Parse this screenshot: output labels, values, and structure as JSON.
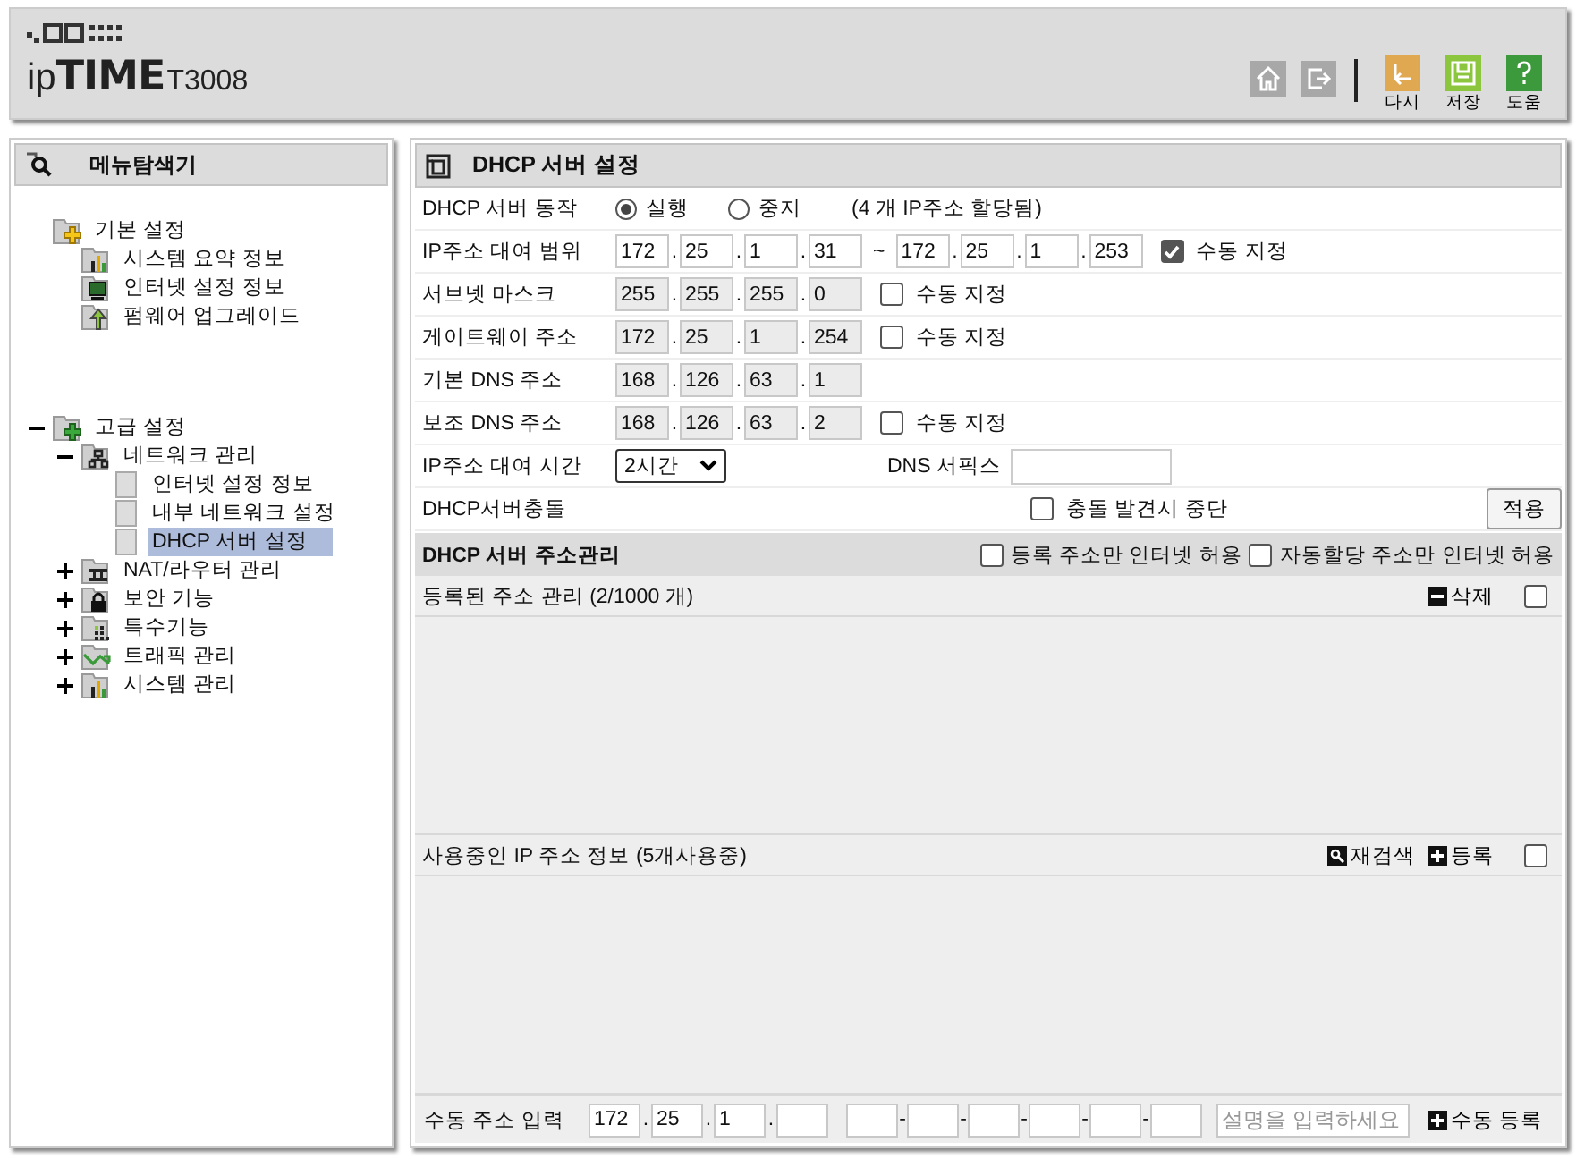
{
  "header": {
    "logo": {
      "prefix": "ip",
      "name": "TIME",
      "model": "T3008"
    },
    "tools": [
      {
        "kind": "home"
      },
      {
        "kind": "logout"
      }
    ],
    "actions": [
      {
        "kind": "undo",
        "label": "다시",
        "color": "#e0a850"
      },
      {
        "kind": "save",
        "label": "저장",
        "color": "#8cc63e"
      },
      {
        "kind": "help",
        "label": "도움",
        "color": "#3c9a3c"
      }
    ]
  },
  "sidebar": {
    "title": "메뉴탐색기",
    "tree": [
      {
        "label": "기본 설정",
        "kind": "folder-star",
        "children": [
          {
            "label": "시스템 요약 정보",
            "kind": "chart",
            "selected": false
          },
          {
            "label": "인터넷 설정 정보",
            "kind": "monitor",
            "selected": false
          },
          {
            "label": "펌웨어 업그레이드",
            "kind": "upload",
            "selected": false
          }
        ]
      },
      {
        "label": "고급 설정",
        "kind": "folder-plus",
        "expanded": true,
        "children": [
          {
            "label": "네트워크 관리",
            "kind": "network",
            "expanded": true,
            "children": [
              {
                "label": "인터넷 설정 정보",
                "kind": "page",
                "selected": false
              },
              {
                "label": "내부 네트워크 설정",
                "kind": "page",
                "selected": false
              },
              {
                "label": "DHCP 서버 설정",
                "kind": "page",
                "selected": true
              }
            ]
          },
          {
            "label": "NAT/라우터 관리",
            "kind": "router",
            "expanded": false
          },
          {
            "label": "보안 기능",
            "kind": "lock",
            "expanded": false
          },
          {
            "label": "특수기능",
            "kind": "grid",
            "expanded": false
          },
          {
            "label": "트래픽 관리",
            "kind": "traffic",
            "expanded": false
          },
          {
            "label": "시스템 관리",
            "kind": "chart",
            "expanded": false
          }
        ]
      }
    ]
  },
  "main": {
    "title": "DHCP 서버 설정",
    "rows": [
      {
        "kind": "radio",
        "label": "DHCP 서버 동작",
        "options": [
          {
            "label": "실행",
            "selected": true
          },
          {
            "label": "중지",
            "selected": false
          }
        ],
        "note": "(4 개 IP주소 할당됨)"
      },
      {
        "kind": "range",
        "label": "IP주소 대여 범위",
        "from": [
          "172",
          "25",
          "1",
          "31"
        ],
        "separator": "~",
        "to": [
          "172",
          "25",
          "1",
          "253"
        ],
        "manual": {
          "label": "수동 지정",
          "checked": true
        }
      },
      {
        "kind": "ip",
        "label": "서브넷 마스크",
        "octets": [
          "255",
          "255",
          "255",
          "0"
        ],
        "disabled": true,
        "manual": {
          "label": "수동 지정",
          "checked": false
        }
      },
      {
        "kind": "ip",
        "label": "게이트웨이 주소",
        "octets": [
          "172",
          "25",
          "1",
          "254"
        ],
        "disabled": true,
        "manual": {
          "label": "수동 지정",
          "checked": false
        }
      },
      {
        "kind": "ip",
        "label": "기본 DNS 주소",
        "octets": [
          "168",
          "126",
          "63",
          "1"
        ],
        "disabled": true
      },
      {
        "kind": "ip",
        "label": "보조 DNS 주소",
        "octets": [
          "168",
          "126",
          "63",
          "2"
        ],
        "disabled": true,
        "manual": {
          "label": "수동 지정",
          "checked": false
        }
      },
      {
        "kind": "lease",
        "label": "IP주소 대여 시간",
        "value": "2시간",
        "suffix_label": "DNS 서픽스"
      },
      {
        "kind": "conflict",
        "label": "DHCP서버충돌",
        "option": {
          "label": "충돌 발견시 중단",
          "checked": false
        },
        "button": "적용"
      }
    ],
    "dot": ".",
    "address": {
      "title": "DHCP 서버 주소관리",
      "options": [
        {
          "label": "등록 주소만 인터넷 허용",
          "checked": false
        },
        {
          "label": "자동할당 주소만 인터넷 허용",
          "checked": false
        }
      ],
      "sections": [
        {
          "title": "등록된 주소 관리 (2/1000 개)",
          "actions": [
            {
              "kind": "minus",
              "label": "삭제"
            }
          ],
          "checked": false
        },
        {
          "title": "사용중인 IP 주소 정보 (5개사용중)",
          "actions": [
            {
              "kind": "search",
              "label": "재검색"
            },
            {
              "kind": "plus",
              "label": "등록"
            }
          ],
          "checked": false
        }
      ]
    },
    "manual_entry": {
      "label": "수동 주소 입력",
      "octets": [
        "172",
        "25",
        "1"
      ],
      "mac_separator": "-",
      "placeholder": "설명을 입력하세요",
      "button": {
        "kind": "plus",
        "label": "수동 등록"
      }
    }
  }
}
